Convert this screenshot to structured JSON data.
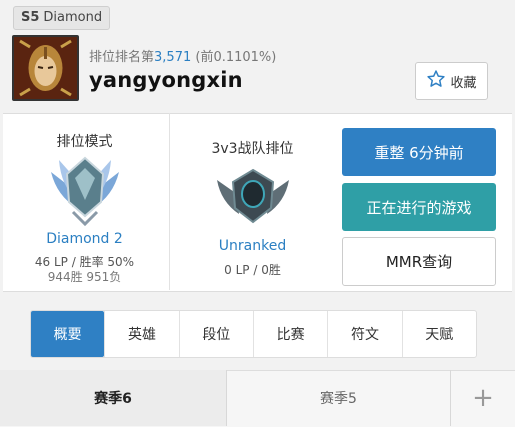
{
  "header": {
    "season_tag": "S5",
    "season_tier": "Diamond",
    "rank_prefix": "排位排名第",
    "rank_number": "3,571",
    "rank_percent": "(前0.1101%)",
    "username": "yangyongxin",
    "favorite_label": "收藏",
    "avatar_icon": "champion-portrait-icon",
    "favorite_icon": "star-outline-icon"
  },
  "ranked_solo": {
    "title": "排位模式",
    "tier": "Diamond 2",
    "lp_winrate": "46 LP / 胜率 50%",
    "wins_losses": "944胜 951负",
    "emblem_icon": "diamond-tier-emblem-icon"
  },
  "ranked_3v3": {
    "title": "3v3战队排位",
    "tier": "Unranked",
    "lp_wins": "0 LP / 0胜",
    "emblem_icon": "unranked-emblem-icon"
  },
  "actions": {
    "update": "重整 6分钟前",
    "live_game": "正在进行的游戏",
    "mmr": "MMR查询"
  },
  "tabs": [
    "概要",
    "英雄",
    "段位",
    "比赛",
    "符文",
    "天赋"
  ],
  "active_tab": "概要",
  "seasons": {
    "current": "赛季6",
    "previous": "赛季5",
    "more": "+"
  },
  "colors": {
    "accent_blue": "#2f80c4",
    "teal": "#2f9fa6",
    "link_blue": "#2b7fc2"
  }
}
